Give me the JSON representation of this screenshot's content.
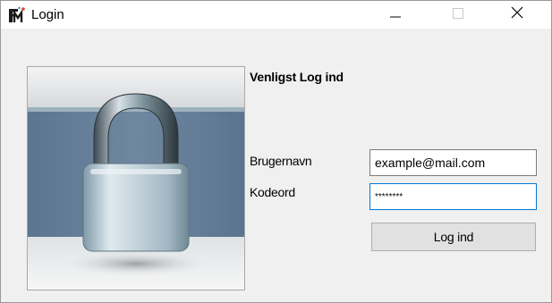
{
  "window": {
    "title": "Login",
    "icon": "app-logo-icon",
    "controls": {
      "minimize_icon": "minimize-icon",
      "maximize_icon": "maximize-icon",
      "close_icon": "close-icon"
    }
  },
  "login": {
    "heading": "Venligst Log ind",
    "picture": "padlock-image",
    "username_label": "Brugernavn",
    "username_value": "example@mail.com",
    "password_label": "Kodeord",
    "password_value": "********",
    "submit_label": "Log ind"
  },
  "colors": {
    "window_background": "#f0f0f0",
    "titlebar_background": "#ffffff",
    "focus_border": "#0078d7",
    "button_background": "#e1e1e1"
  }
}
